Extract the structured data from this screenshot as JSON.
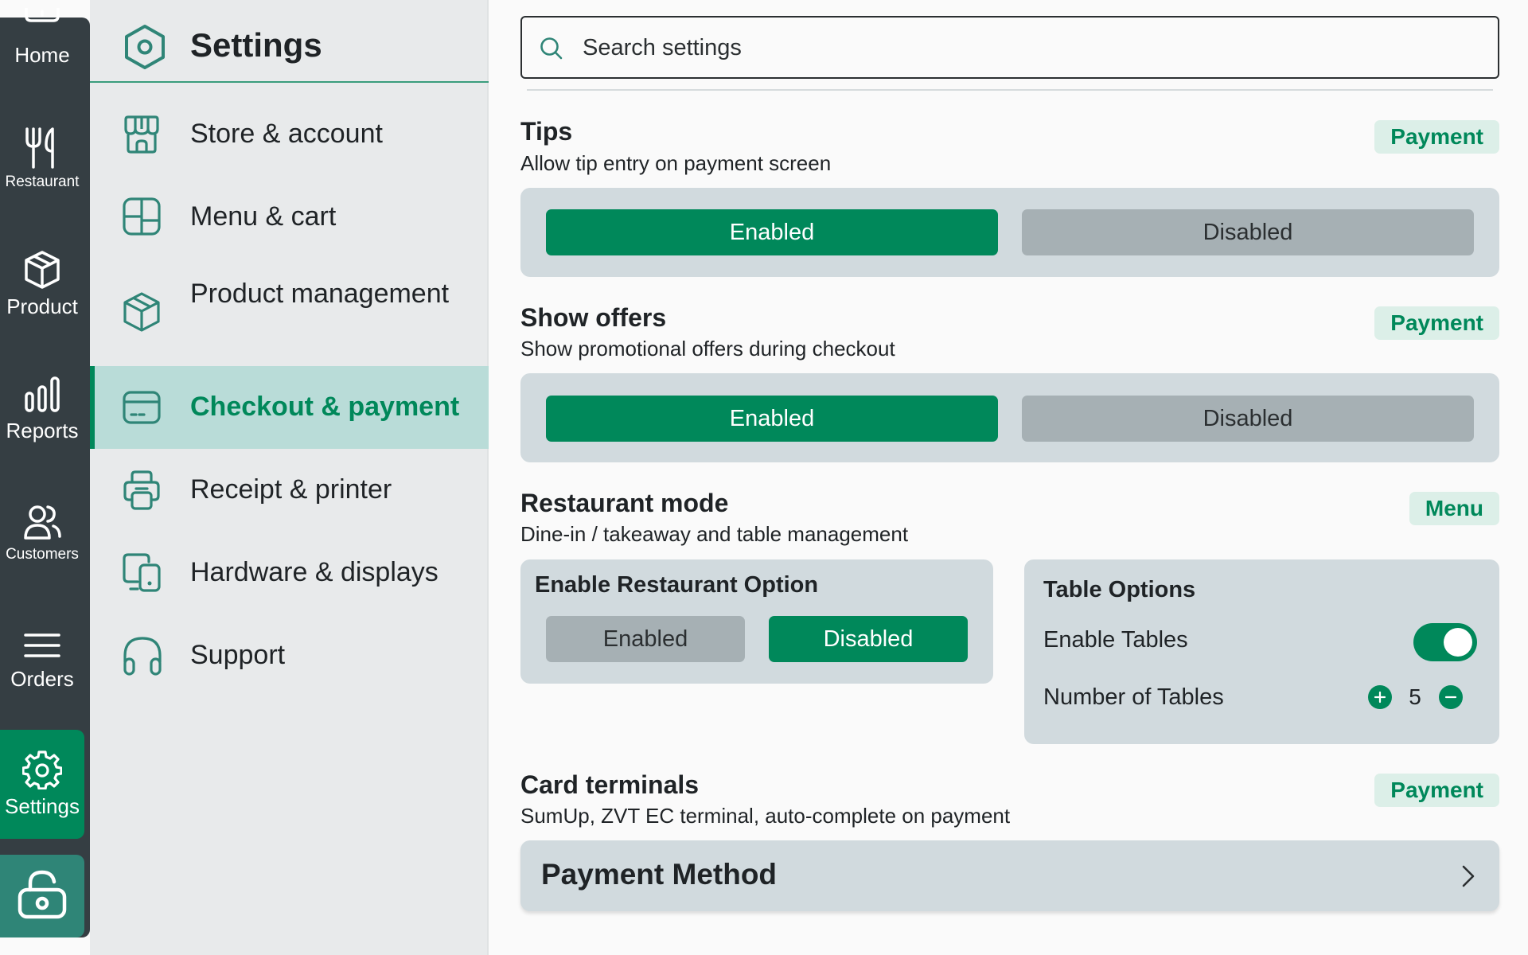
{
  "rail": {
    "items": [
      {
        "label": "Home",
        "icon": "home-icon"
      },
      {
        "label": "Restaurant",
        "icon": "cutlery-icon"
      },
      {
        "label": "Product",
        "icon": "box-icon"
      },
      {
        "label": "Reports",
        "icon": "bar-chart-icon"
      },
      {
        "label": "Customers",
        "icon": "users-icon"
      },
      {
        "label": "Orders",
        "icon": "menu-lines-icon"
      },
      {
        "label": "Settings",
        "icon": "gear-icon",
        "active": true
      }
    ],
    "lock_icon": "lock-icon"
  },
  "nav": {
    "title": "Settings",
    "items": [
      {
        "label": "Store & account",
        "icon": "store-icon"
      },
      {
        "label": "Menu & cart",
        "icon": "grid-icon"
      },
      {
        "label": "Product management",
        "icon": "box-icon"
      },
      {
        "label": "Checkout & payment",
        "icon": "card-icon",
        "active": true
      },
      {
        "label": "Receipt & printer",
        "icon": "printer-icon"
      },
      {
        "label": "Hardware & displays",
        "icon": "devices-icon"
      },
      {
        "label": "Support",
        "icon": "headset-icon"
      }
    ]
  },
  "search": {
    "placeholder": "Search settings"
  },
  "sections": {
    "tips": {
      "title": "Tips",
      "description": "Allow tip entry on payment screen",
      "badge": "Payment",
      "enabled_label": "Enabled",
      "disabled_label": "Disabled",
      "selected": "Enabled"
    },
    "offers": {
      "title": "Show offers",
      "description": "Show promotional offers during checkout",
      "badge": "Payment",
      "enabled_label": "Enabled",
      "disabled_label": "Disabled",
      "selected": "Enabled"
    },
    "restaurant": {
      "title": "Restaurant mode",
      "description": "Dine-in / takeaway and table management",
      "badge": "Menu",
      "option_title": "Enable Restaurant Option",
      "enabled_label": "Enabled",
      "disabled_label": "Disabled",
      "selected": "Disabled",
      "table_options": {
        "title": "Table Options",
        "enable_tables_label": "Enable Tables",
        "enable_tables": true,
        "number_label": "Number of Tables",
        "number_value": "5"
      }
    },
    "card_terminals": {
      "title": "Card terminals",
      "description": "SumUp, ZVT EC terminal, auto-complete on payment",
      "badge": "Payment",
      "payment_method_label": "Payment Method"
    }
  },
  "colors": {
    "accent": "#00885a",
    "rail_bg": "#353e43",
    "card_bg": "#d1dade",
    "badge_bg": "#dcefe8",
    "nav_active_bg": "#b9dcd8"
  }
}
